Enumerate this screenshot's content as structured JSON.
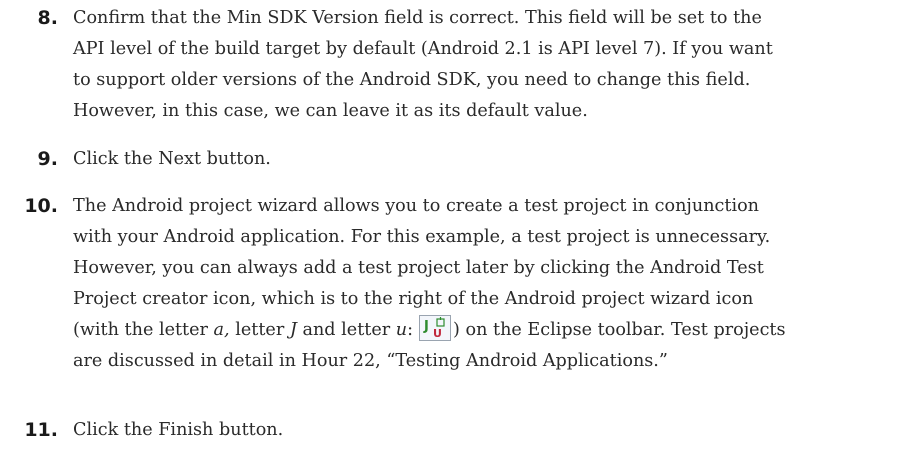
{
  "steps": [
    {
      "number": "8.",
      "lines": [
        "Confirm that the Min SDK Version field is correct. This field will be set to the",
        "API level of the build target by default (Android 2.1 is API level 7). If you want",
        "to support older versions of the Android SDK, you need to change this field.",
        "However, in this case, we can leave it as its default value."
      ]
    },
    {
      "number": "9.",
      "lines": [
        "Click the Next button."
      ]
    },
    {
      "number": "10.",
      "lines": [
        "The Android project wizard allows you to create a test project in conjunction",
        "with your Android application. For this example, a test project is unnecessary.",
        "However, you can always add a test project later by clicking the Android Test",
        "Project creator icon, which is to the right of the Android project wizard icon"
      ],
      "icon_line": {
        "prefix": "(with the letter ",
        "letter_a": "a,",
        "middle1": " letter ",
        "letter_j": "J",
        "middle2": " and letter ",
        "letter_u": "u",
        "colon": ":",
        "suffix": ") on the Eclipse toolbar. Test projects",
        "icon_name": "junit-test-project-icon"
      },
      "last_line": "are discussed in detail in Hour 22, “Testing Android Applications.”"
    },
    {
      "number": "11.",
      "lines": [
        "Click the Finish button."
      ]
    }
  ]
}
